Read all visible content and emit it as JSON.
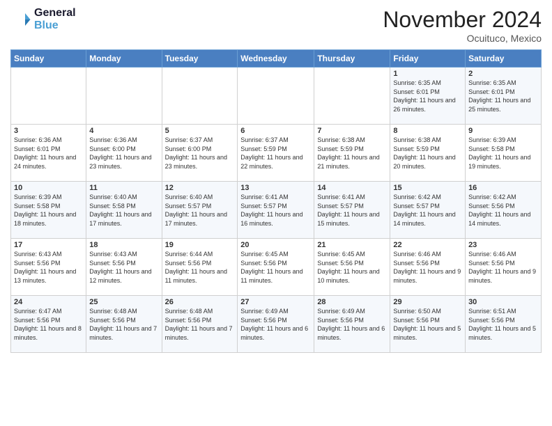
{
  "logo": {
    "line1": "General",
    "line2": "Blue"
  },
  "title": "November 2024",
  "location": "Ocuituco, Mexico",
  "days_of_week": [
    "Sunday",
    "Monday",
    "Tuesday",
    "Wednesday",
    "Thursday",
    "Friday",
    "Saturday"
  ],
  "weeks": [
    [
      {
        "day": "",
        "sunrise": "",
        "sunset": "",
        "daylight": ""
      },
      {
        "day": "",
        "sunrise": "",
        "sunset": "",
        "daylight": ""
      },
      {
        "day": "",
        "sunrise": "",
        "sunset": "",
        "daylight": ""
      },
      {
        "day": "",
        "sunrise": "",
        "sunset": "",
        "daylight": ""
      },
      {
        "day": "",
        "sunrise": "",
        "sunset": "",
        "daylight": ""
      },
      {
        "day": "1",
        "sunrise": "Sunrise: 6:35 AM",
        "sunset": "Sunset: 6:01 PM",
        "daylight": "Daylight: 11 hours and 26 minutes."
      },
      {
        "day": "2",
        "sunrise": "Sunrise: 6:35 AM",
        "sunset": "Sunset: 6:01 PM",
        "daylight": "Daylight: 11 hours and 25 minutes."
      }
    ],
    [
      {
        "day": "3",
        "sunrise": "Sunrise: 6:36 AM",
        "sunset": "Sunset: 6:01 PM",
        "daylight": "Daylight: 11 hours and 24 minutes."
      },
      {
        "day": "4",
        "sunrise": "Sunrise: 6:36 AM",
        "sunset": "Sunset: 6:00 PM",
        "daylight": "Daylight: 11 hours and 23 minutes."
      },
      {
        "day": "5",
        "sunrise": "Sunrise: 6:37 AM",
        "sunset": "Sunset: 6:00 PM",
        "daylight": "Daylight: 11 hours and 23 minutes."
      },
      {
        "day": "6",
        "sunrise": "Sunrise: 6:37 AM",
        "sunset": "Sunset: 5:59 PM",
        "daylight": "Daylight: 11 hours and 22 minutes."
      },
      {
        "day": "7",
        "sunrise": "Sunrise: 6:38 AM",
        "sunset": "Sunset: 5:59 PM",
        "daylight": "Daylight: 11 hours and 21 minutes."
      },
      {
        "day": "8",
        "sunrise": "Sunrise: 6:38 AM",
        "sunset": "Sunset: 5:59 PM",
        "daylight": "Daylight: 11 hours and 20 minutes."
      },
      {
        "day": "9",
        "sunrise": "Sunrise: 6:39 AM",
        "sunset": "Sunset: 5:58 PM",
        "daylight": "Daylight: 11 hours and 19 minutes."
      }
    ],
    [
      {
        "day": "10",
        "sunrise": "Sunrise: 6:39 AM",
        "sunset": "Sunset: 5:58 PM",
        "daylight": "Daylight: 11 hours and 18 minutes."
      },
      {
        "day": "11",
        "sunrise": "Sunrise: 6:40 AM",
        "sunset": "Sunset: 5:58 PM",
        "daylight": "Daylight: 11 hours and 17 minutes."
      },
      {
        "day": "12",
        "sunrise": "Sunrise: 6:40 AM",
        "sunset": "Sunset: 5:57 PM",
        "daylight": "Daylight: 11 hours and 17 minutes."
      },
      {
        "day": "13",
        "sunrise": "Sunrise: 6:41 AM",
        "sunset": "Sunset: 5:57 PM",
        "daylight": "Daylight: 11 hours and 16 minutes."
      },
      {
        "day": "14",
        "sunrise": "Sunrise: 6:41 AM",
        "sunset": "Sunset: 5:57 PM",
        "daylight": "Daylight: 11 hours and 15 minutes."
      },
      {
        "day": "15",
        "sunrise": "Sunrise: 6:42 AM",
        "sunset": "Sunset: 5:57 PM",
        "daylight": "Daylight: 11 hours and 14 minutes."
      },
      {
        "day": "16",
        "sunrise": "Sunrise: 6:42 AM",
        "sunset": "Sunset: 5:56 PM",
        "daylight": "Daylight: 11 hours and 14 minutes."
      }
    ],
    [
      {
        "day": "17",
        "sunrise": "Sunrise: 6:43 AM",
        "sunset": "Sunset: 5:56 PM",
        "daylight": "Daylight: 11 hours and 13 minutes."
      },
      {
        "day": "18",
        "sunrise": "Sunrise: 6:43 AM",
        "sunset": "Sunset: 5:56 PM",
        "daylight": "Daylight: 11 hours and 12 minutes."
      },
      {
        "day": "19",
        "sunrise": "Sunrise: 6:44 AM",
        "sunset": "Sunset: 5:56 PM",
        "daylight": "Daylight: 11 hours and 11 minutes."
      },
      {
        "day": "20",
        "sunrise": "Sunrise: 6:45 AM",
        "sunset": "Sunset: 5:56 PM",
        "daylight": "Daylight: 11 hours and 11 minutes."
      },
      {
        "day": "21",
        "sunrise": "Sunrise: 6:45 AM",
        "sunset": "Sunset: 5:56 PM",
        "daylight": "Daylight: 11 hours and 10 minutes."
      },
      {
        "day": "22",
        "sunrise": "Sunrise: 6:46 AM",
        "sunset": "Sunset: 5:56 PM",
        "daylight": "Daylight: 11 hours and 9 minutes."
      },
      {
        "day": "23",
        "sunrise": "Sunrise: 6:46 AM",
        "sunset": "Sunset: 5:56 PM",
        "daylight": "Daylight: 11 hours and 9 minutes."
      }
    ],
    [
      {
        "day": "24",
        "sunrise": "Sunrise: 6:47 AM",
        "sunset": "Sunset: 5:56 PM",
        "daylight": "Daylight: 11 hours and 8 minutes."
      },
      {
        "day": "25",
        "sunrise": "Sunrise: 6:48 AM",
        "sunset": "Sunset: 5:56 PM",
        "daylight": "Daylight: 11 hours and 7 minutes."
      },
      {
        "day": "26",
        "sunrise": "Sunrise: 6:48 AM",
        "sunset": "Sunset: 5:56 PM",
        "daylight": "Daylight: 11 hours and 7 minutes."
      },
      {
        "day": "27",
        "sunrise": "Sunrise: 6:49 AM",
        "sunset": "Sunset: 5:56 PM",
        "daylight": "Daylight: 11 hours and 6 minutes."
      },
      {
        "day": "28",
        "sunrise": "Sunrise: 6:49 AM",
        "sunset": "Sunset: 5:56 PM",
        "daylight": "Daylight: 11 hours and 6 minutes."
      },
      {
        "day": "29",
        "sunrise": "Sunrise: 6:50 AM",
        "sunset": "Sunset: 5:56 PM",
        "daylight": "Daylight: 11 hours and 5 minutes."
      },
      {
        "day": "30",
        "sunrise": "Sunrise: 6:51 AM",
        "sunset": "Sunset: 5:56 PM",
        "daylight": "Daylight: 11 hours and 5 minutes."
      }
    ]
  ]
}
